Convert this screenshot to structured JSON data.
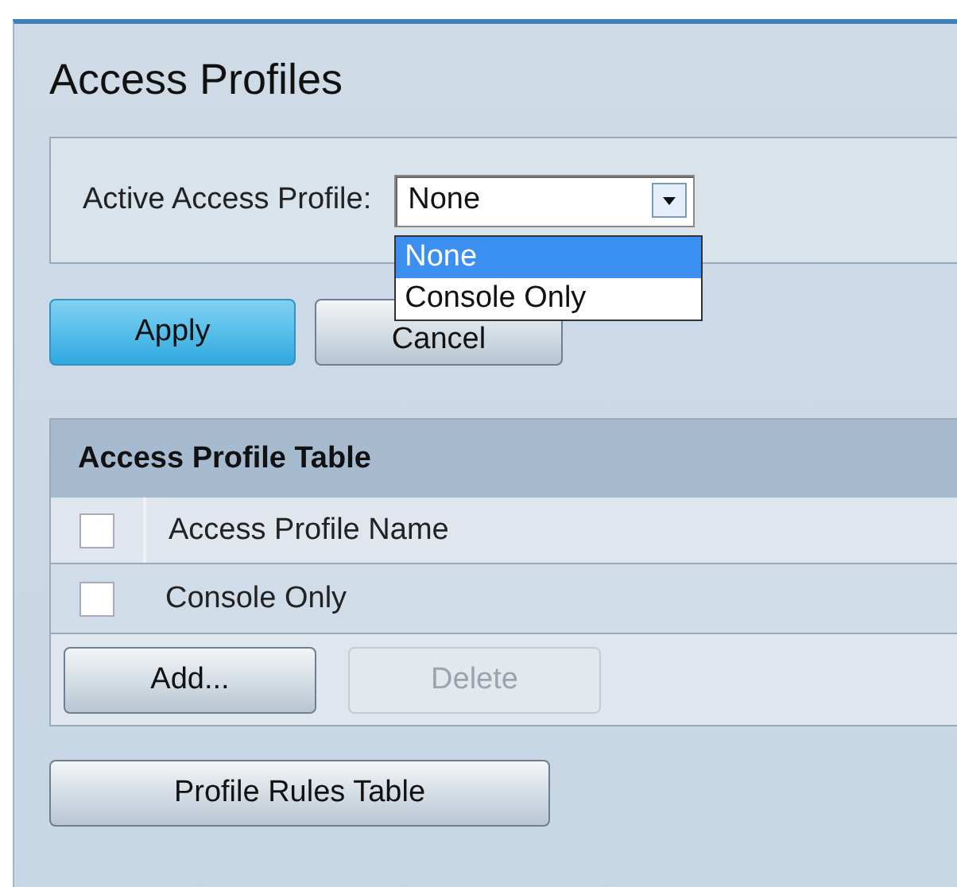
{
  "title": "Access Profiles",
  "active_profile": {
    "label": "Active Access Profile:",
    "value": "None",
    "expanded": true,
    "options": [
      {
        "label": "None",
        "selected": true
      },
      {
        "label": "Console Only",
        "selected": false
      }
    ]
  },
  "form_buttons": [
    {
      "label": "Apply",
      "kind": "primary"
    },
    {
      "label": "Cancel",
      "kind": "normal"
    }
  ],
  "table": {
    "title": "Access Profile Table",
    "header": {
      "label": "Access Profile Name",
      "checked": false
    },
    "rows": [
      {
        "name": "Console Only",
        "checked": false
      }
    ],
    "buttons": [
      {
        "label": "Add...",
        "disabled": false
      },
      {
        "label": "Delete",
        "disabled": true
      }
    ]
  },
  "bottom_button": {
    "label": "Profile Rules Table"
  }
}
